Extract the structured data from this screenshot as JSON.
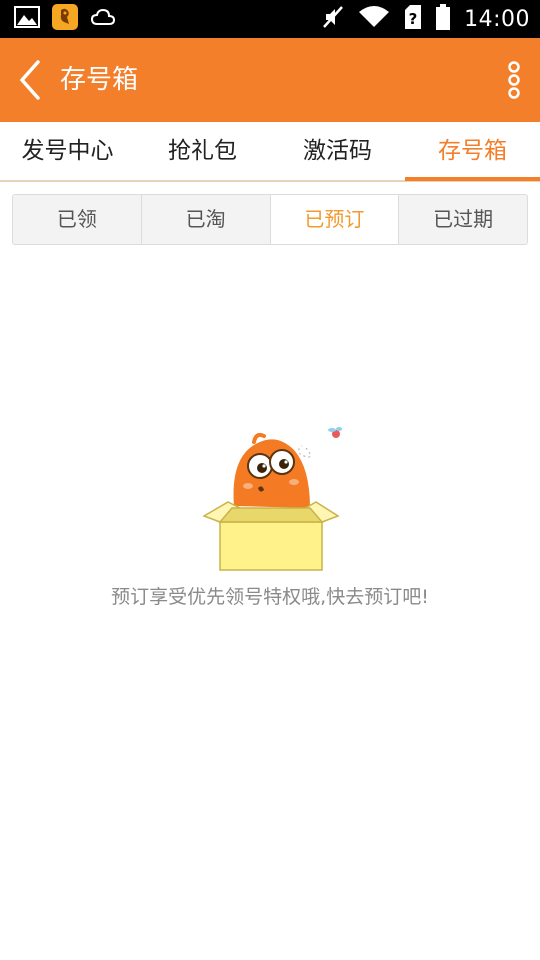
{
  "status_bar": {
    "time": "14:00",
    "left_icons": [
      "image-icon",
      "app-notification-icon",
      "cloud-icon"
    ],
    "right_icons": [
      "mute-icon",
      "wifi-icon",
      "sim-icon",
      "battery-icon"
    ]
  },
  "app_bar": {
    "title": "存号箱",
    "back_icon": "chevron-left-icon",
    "menu_icon": "more-vertical-icon",
    "background": "#f47f2a"
  },
  "tabs": [
    {
      "label": "发号中心",
      "active": false
    },
    {
      "label": "抢礼包",
      "active": false
    },
    {
      "label": "激活码",
      "active": false
    },
    {
      "label": "存号箱",
      "active": true
    }
  ],
  "segments": [
    {
      "label": "已领",
      "active": false
    },
    {
      "label": "已淘",
      "active": false
    },
    {
      "label": "已预订",
      "active": true
    },
    {
      "label": "已过期",
      "active": false
    }
  ],
  "empty_state": {
    "illustration": "mascot-in-box-illustration",
    "message": "预订享受优先领号特权哦,快去预订吧!"
  },
  "colors": {
    "accent": "#f47f2a",
    "active_segment_text": "#f29a2e",
    "tab_text": "#222222",
    "hint_text": "#8a8a8a"
  }
}
